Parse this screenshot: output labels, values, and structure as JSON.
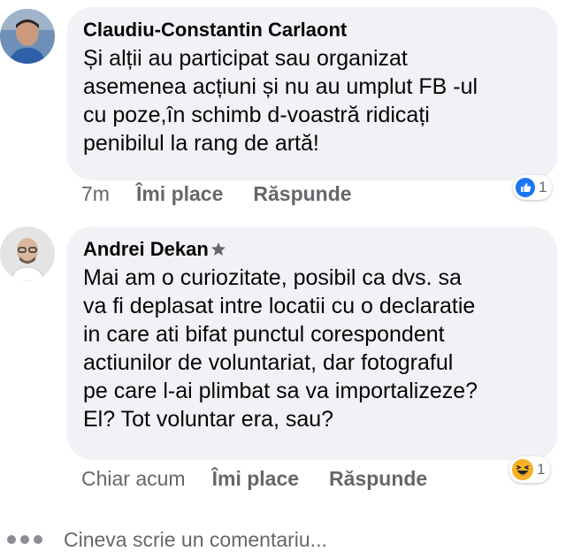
{
  "comments": [
    {
      "author": "Claudiu-Constantin Carlaont",
      "text": "Și alții au participat sau organizat\nasemenea acțiuni și nu au umplut FB -ul\ncu poze,în schimb d-voastră ridicați\npenibilul la rang de artă!",
      "time": "7m",
      "like_label": "Îmi place",
      "reply_label": "Răspunde",
      "reaction_icon": "like-icon",
      "reaction_color": "#1877f2",
      "reaction_count": "1"
    },
    {
      "author": "Andrei Dekan",
      "text": "Mai am o curiozitate, posibil ca dvs. sa\nva fi deplasat intre locatii cu o declaratie\nin care ati bifat punctul corespondent\nactiunilor de voluntariat, dar fotograful\npe care l-ai plimbat sa va importalizeze?\nEl? Tot voluntar era, sau?",
      "time": "Chiar acum",
      "like_label": "Îmi place",
      "reply_label": "Răspunde",
      "reaction_icon": "haha-icon",
      "reaction_color": "#f7b125",
      "reaction_count": "1",
      "author_badge_icon": "star-badge-icon"
    }
  ],
  "composer": {
    "placeholder": "Cineva scrie un comentariu..."
  }
}
